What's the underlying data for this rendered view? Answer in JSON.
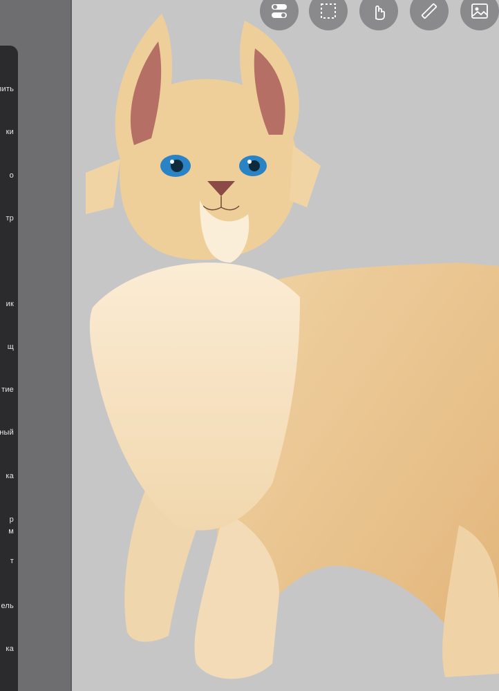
{
  "toolbar": {
    "items": [
      {
        "label": "вить"
      },
      {
        "label": "ки"
      },
      {
        "label": "о"
      },
      {
        "label": "тр"
      },
      {
        "label": "ик"
      },
      {
        "label": "щ"
      },
      {
        "label": "тие"
      },
      {
        "label": "ный"
      },
      {
        "label": "ка"
      },
      {
        "label": "р"
      },
      {
        "label": "м"
      },
      {
        "label": "т"
      },
      {
        "label": "ель"
      },
      {
        "label": "ка"
      }
    ]
  },
  "top_buttons": [
    {
      "icon": "toggle-icon"
    },
    {
      "icon": "selection-icon"
    },
    {
      "icon": "hand-icon"
    },
    {
      "icon": "ruler-icon"
    },
    {
      "icon": "image-icon"
    }
  ],
  "colors": {
    "canvas_bg": "#c6c6c6",
    "panel_bg": "#2b2b2d",
    "strip_bg": "#6e6e70",
    "button_bg": "#8a8a8c",
    "accent": "#2f9bff"
  }
}
